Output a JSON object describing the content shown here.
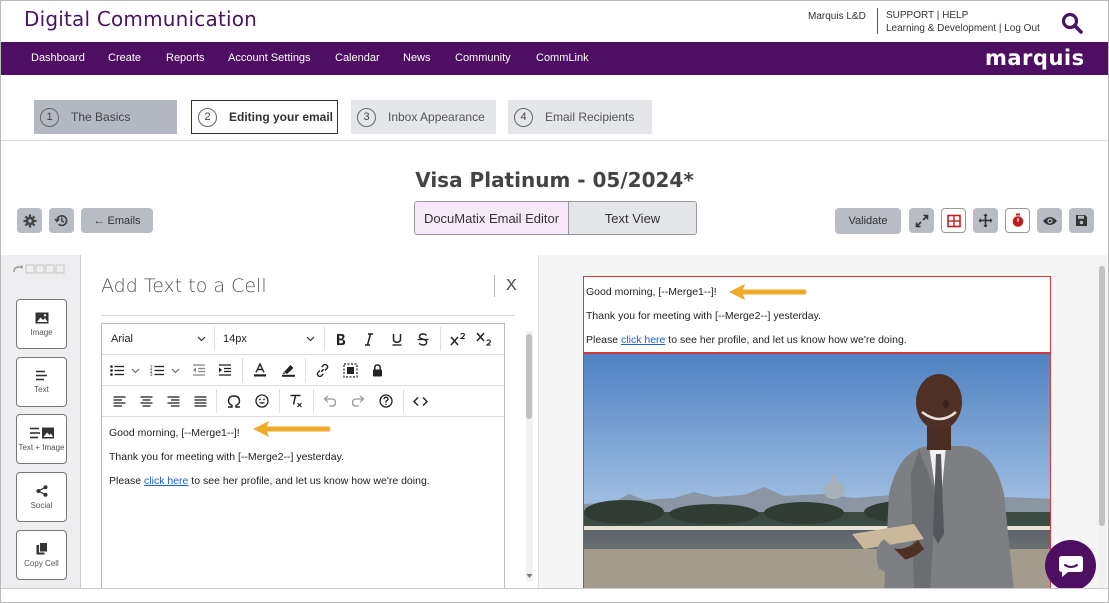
{
  "app": {
    "title": "Digital Communication",
    "org": "Marquis L&D",
    "support_line": "SUPPORT | HELP",
    "account_line": "Learning & Development | Log Out",
    "brand": "marquis"
  },
  "nav": {
    "items": [
      "Dashboard",
      "Create",
      "Reports",
      "Account Settings",
      "Calendar",
      "News",
      "Community",
      "CommLink"
    ]
  },
  "steps": [
    {
      "num": "1",
      "label": "The Basics"
    },
    {
      "num": "2",
      "label": "Editing your email"
    },
    {
      "num": "3",
      "label": "Inbox Appearance"
    },
    {
      "num": "4",
      "label": "Email Recipients"
    }
  ],
  "email": {
    "title": "Visa Platinum - 05/2024*",
    "back_label": "← Emails",
    "editor_tab": "DocuMatix Email Editor",
    "text_tab": "Text View",
    "validate_label": "Validate"
  },
  "sidebar": {
    "items": [
      "Image",
      "Text",
      "Text + Image",
      "Social",
      "Copy Cell"
    ]
  },
  "panel": {
    "title": "Add Text to a Cell",
    "close": "X",
    "font_family": "Arial",
    "font_size": "14px"
  },
  "content": {
    "line1": "Good morning, [--Merge1--]!",
    "line2": "Thank you for meeting with [--Merge2--] yesterday.",
    "line3_pre": "Please ",
    "line3_link": "click here",
    "line3_post": " to see her profile, and let us know how we're doing."
  },
  "colors": {
    "brand_purple": "#4e0f63",
    "title_purple": "#4a1461",
    "arrow_orange": "#f0a92a",
    "selection_red": "#d23a3a"
  }
}
